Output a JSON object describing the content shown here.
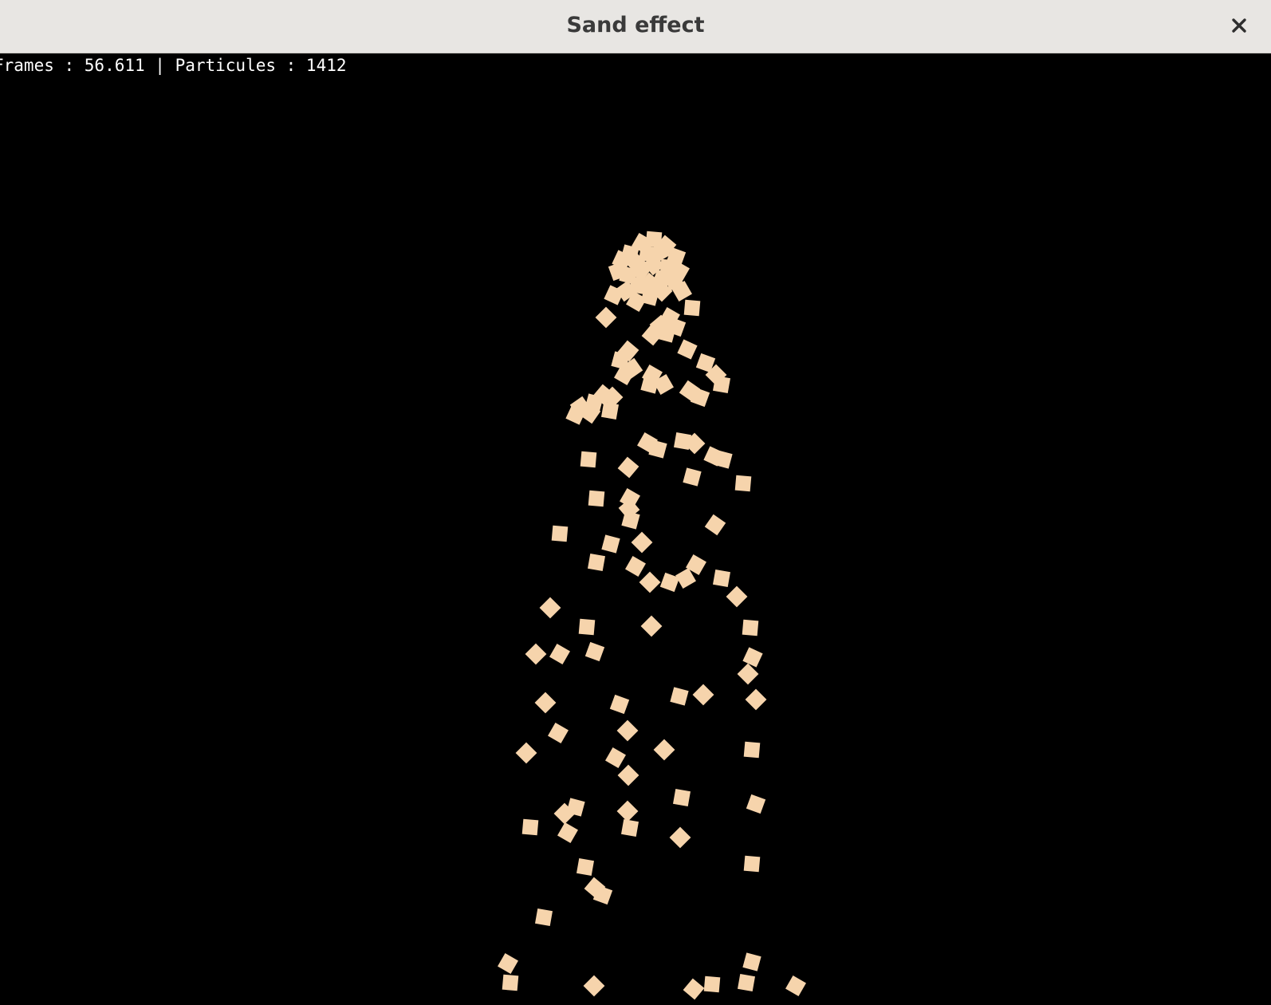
{
  "window": {
    "title": "Sand effect",
    "close_icon": "close-icon"
  },
  "stats": {
    "text": "Frames : 56.611 | Particules : 1412"
  },
  "colors": {
    "titlebar_bg": "#e8e6e3",
    "canvas_bg": "#000000",
    "particle": "#f6d4ac",
    "stats_text": "#ffffff"
  }
}
